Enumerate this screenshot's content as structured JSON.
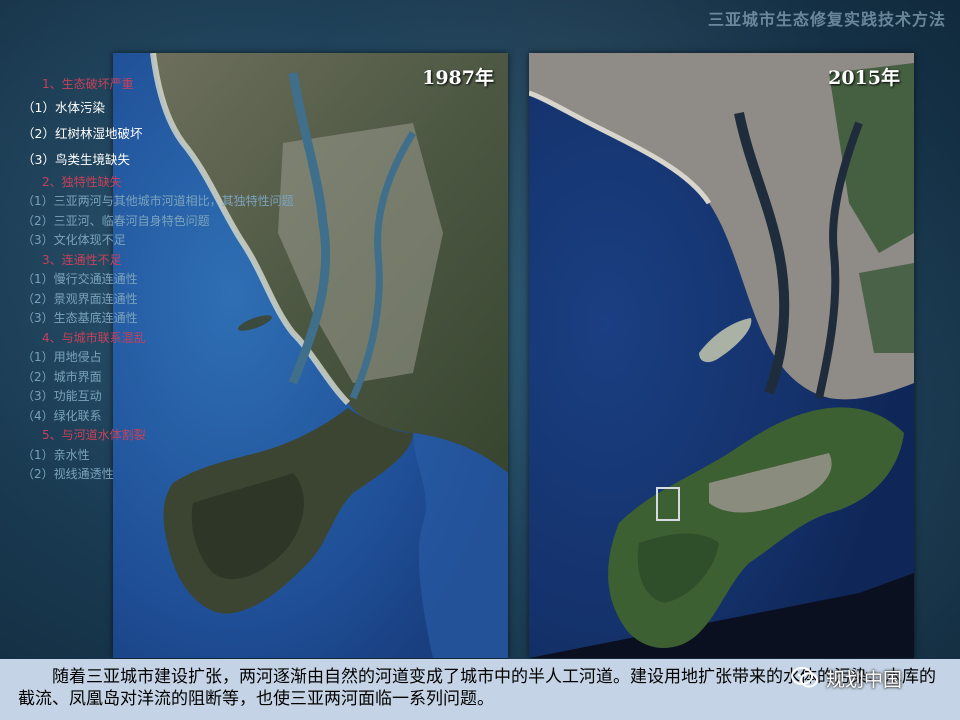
{
  "deck_title": "三亚城市生态修复实践技术方法",
  "photos": [
    {
      "year_label": "1987年"
    },
    {
      "year_label": "2015年"
    }
  ],
  "outline": [
    {
      "heading": "1、生态破坏严重",
      "items": [
        "（1）水体污染",
        "（2）红树林湿地破坏",
        "（3）鸟类生境缺失"
      ]
    },
    {
      "heading": "2、独特性缺失",
      "items": [
        "（1）三亚两河与其他城市河道相比，其独特性问题",
        "（2）三亚河、临春河自身特色问题",
        "（3）文化体现不足"
      ]
    },
    {
      "heading": "3、连通性不足",
      "items": [
        "（1）慢行交通连通性",
        "（2）景观界面连通性",
        "（3）生态基底连通性"
      ]
    },
    {
      "heading": "4、与城市联系混乱",
      "items": [
        "（1）用地侵占",
        "（2）城市界面",
        "（3）功能互动",
        "（4）绿化联系"
      ]
    },
    {
      "heading": "5、与河道水体割裂",
      "items": [
        "（1）亲水性",
        "（2）视线通透性"
      ]
    }
  ],
  "caption": "随着三亚城市建设扩张，两河逐渐由自然的河道变成了城市中的半人工河道。建设用地扩张带来的水体的污染、水库的截流、凤凰岛对洋流的阻断等，也使三亚两河面临一系列问题。",
  "watermark": {
    "text": "规划中国",
    "icon": "wechat-icon"
  },
  "colors": {
    "heading": "#c7405a",
    "item": "#7aa3bb",
    "highlight": "#ffffff",
    "caption_bar": "#c4d4e6"
  }
}
